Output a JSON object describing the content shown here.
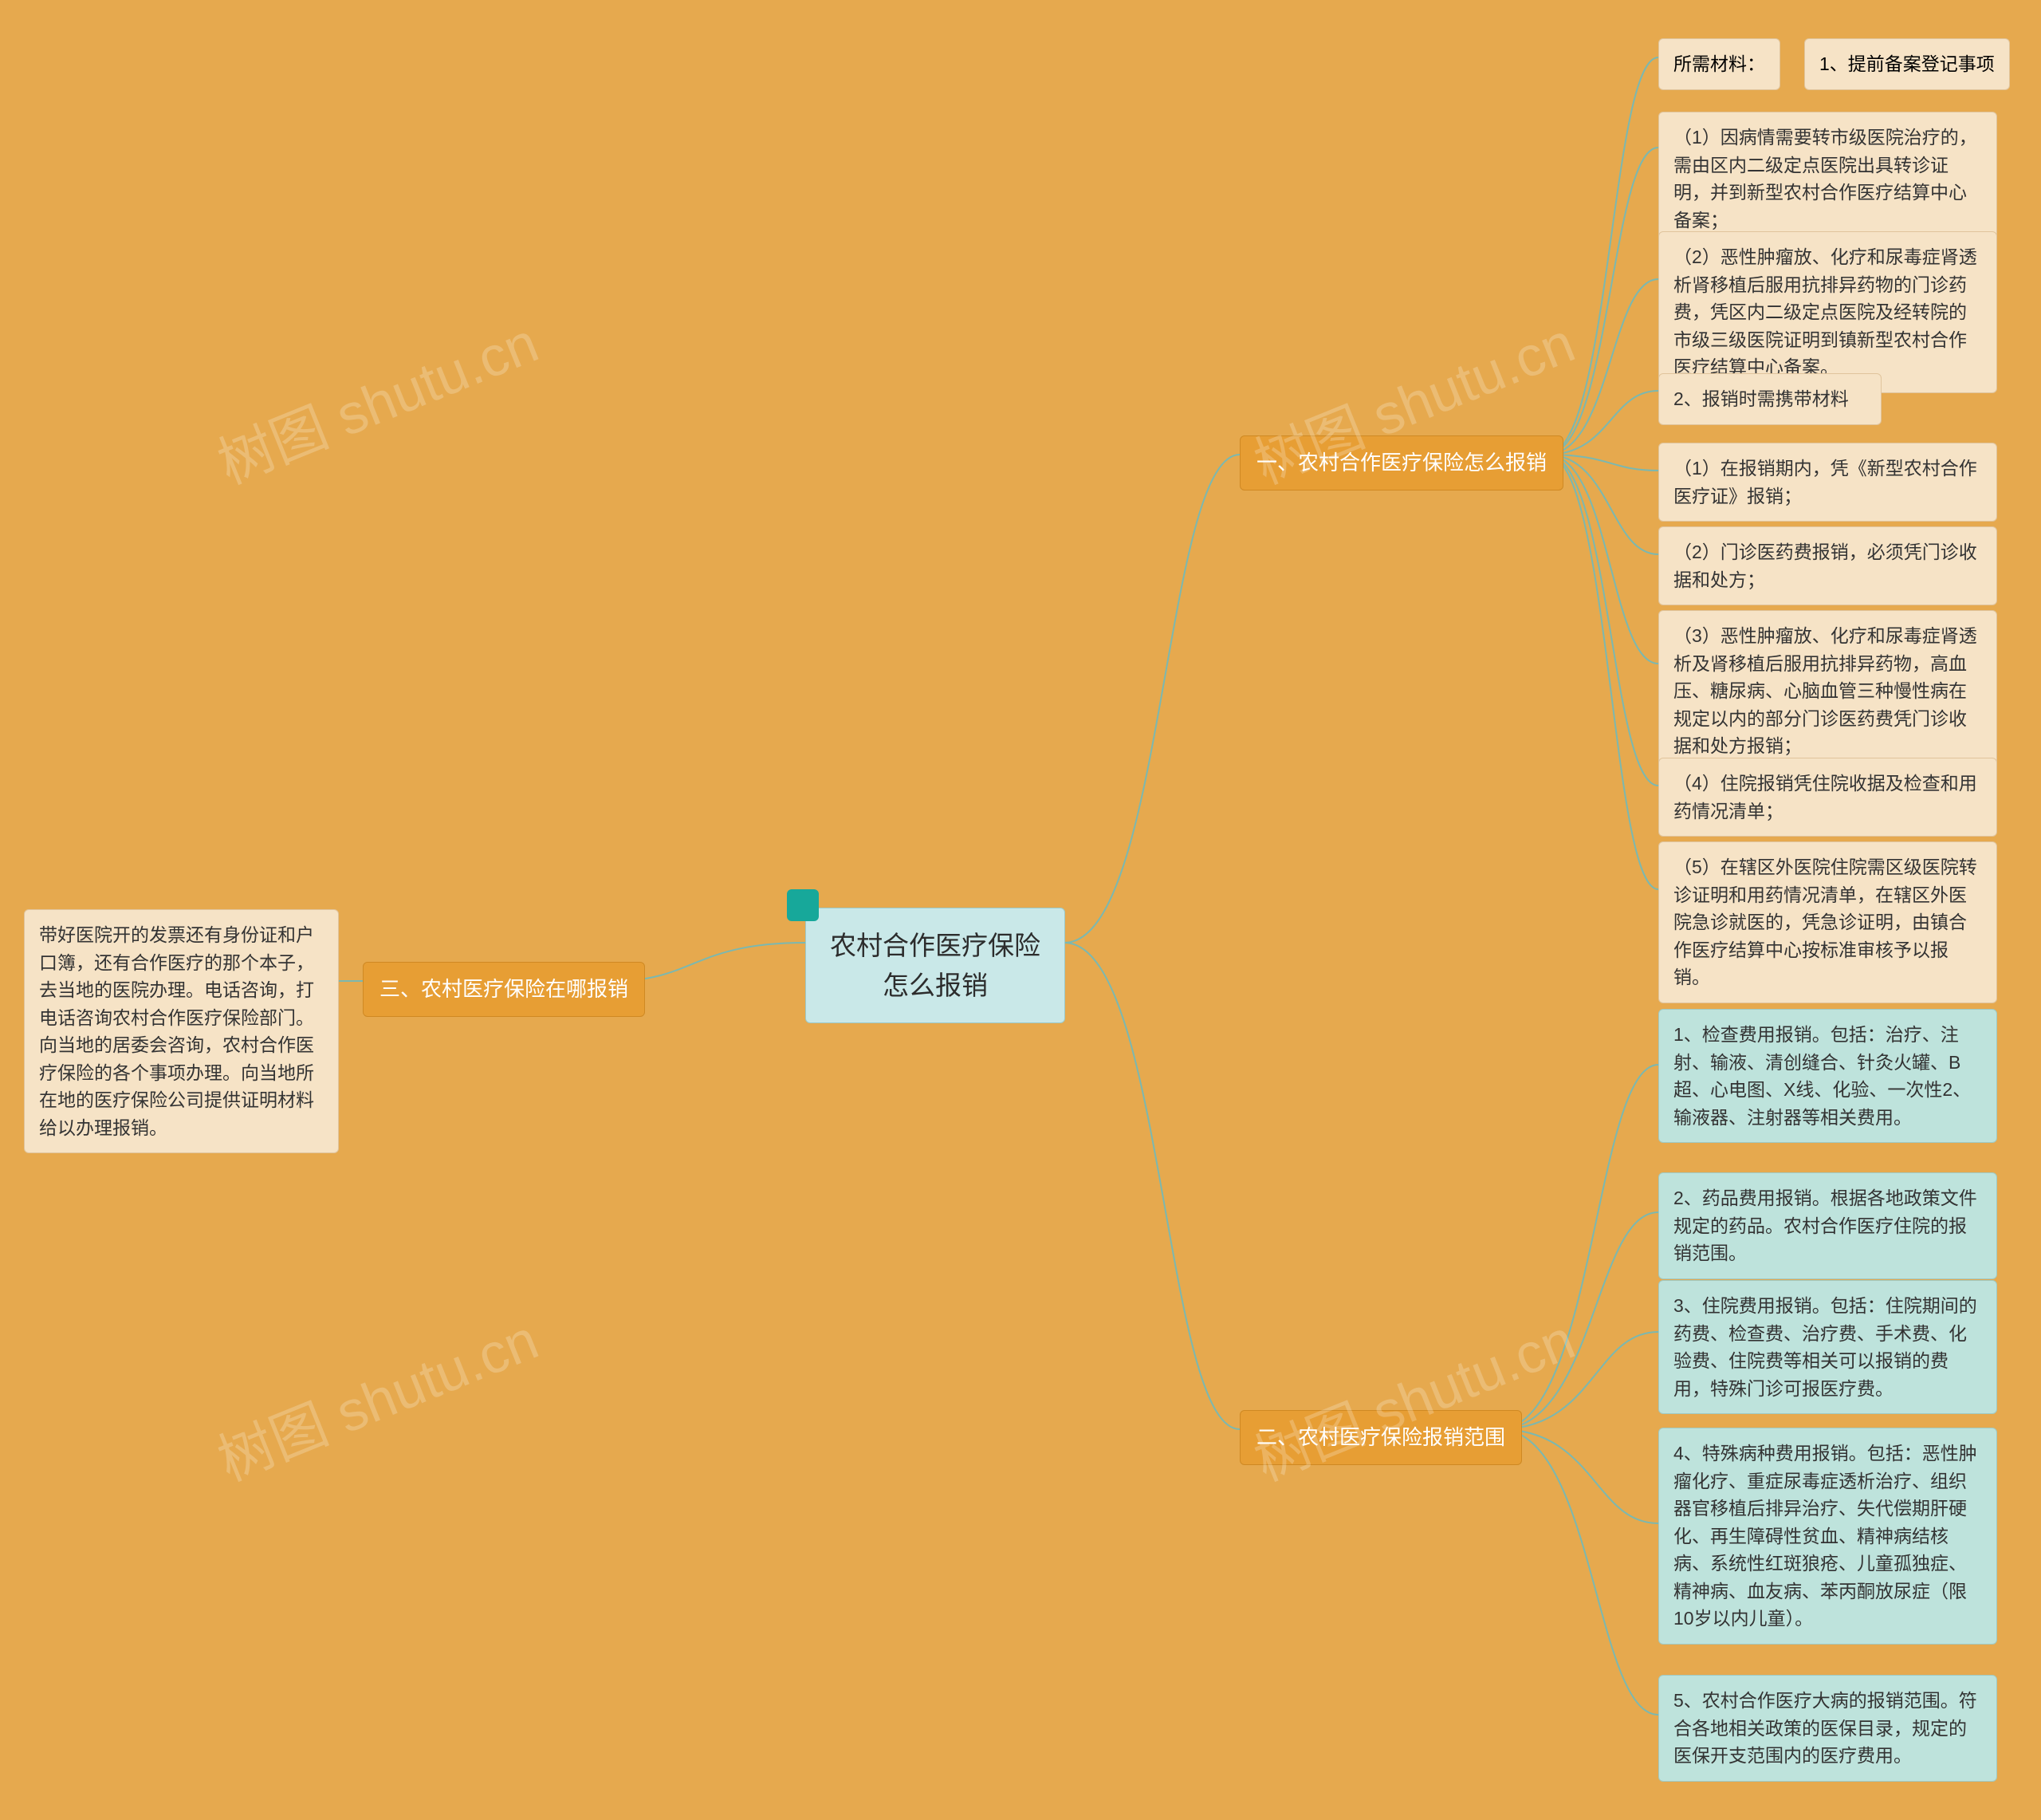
{
  "root": "农村合作医疗保险怎么报销",
  "branch1": {
    "title": "一、农村合作医疗保险怎么报销",
    "leaves": [
      {
        "left": "所需材料：",
        "right": "1、提前备案登记事项"
      },
      "（1）因病情需要转市级医院治疗的，需由区内二级定点医院出具转诊证明，并到新型农村合作医疗结算中心备案；",
      "（2）恶性肿瘤放、化疗和尿毒症肾透析肾移植后服用抗排异药物的门诊药费，凭区内二级定点医院及经转院的市级三级医院证明到镇新型农村合作医疗结算中心备案。",
      "2、报销时需携带材料",
      "（1）在报销期内，凭《新型农村合作医疗证》报销；",
      "（2）门诊医药费报销，必须凭门诊收据和处方；",
      "（3）恶性肿瘤放、化疗和尿毒症肾透析及肾移植后服用抗排异药物，高血压、糖尿病、心脑血管三种慢性病在规定以内的部分门诊医药费凭门诊收据和处方报销；",
      "（4）住院报销凭住院收据及检查和用药情况清单；",
      "（5）在辖区外医院住院需区级医院转诊证明和用药情况清单，在辖区外医院急诊就医的，凭急诊证明，由镇合作医疗结算中心按标准审核予以报销。"
    ]
  },
  "branch2": {
    "title": "二、农村医疗保险报销范围",
    "leaves": [
      "1、检查费用报销。包括：治疗、注射、输液、清创缝合、针灸火罐、B超、心电图、X线、化验、一次性2、输液器、注射器等相关费用。",
      "2、药品费用报销。根据各地政策文件规定的药品。农村合作医疗住院的报销范围。",
      "3、住院费用报销。包括：住院期间的药费、检查费、治疗费、手术费、化验费、住院费等相关可以报销的费用，特殊门诊可报医疗费。",
      "4、特殊病种费用报销。包括：恶性肿瘤化疗、重症尿毒症透析治疗、组织器官移植后排异治疗、失代偿期肝硬化、再生障碍性贫血、精神病结核病、系统性红斑狼疮、儿童孤独症、精神病、血友病、苯丙酮放尿症（限10岁以内儿童）。",
      "5、农村合作医疗大病的报销范围。符合各地相关政策的医保目录，规定的医保开支范围内的医疗费用。"
    ]
  },
  "branch3": {
    "title": "三、农村医疗保险在哪报销",
    "leaf": "带好医院开的发票还有身份证和户口簿，还有合作医疗的那个本子，去当地的医院办理。电话咨询，打电话咨询农村合作医疗保险部门。向当地的居委会咨询，农村合作医疗保险的各个事项办理。向当地所在地的医疗保险公司提供证明材料给以办理报销。"
  },
  "watermark": "树图 shutu.cn"
}
